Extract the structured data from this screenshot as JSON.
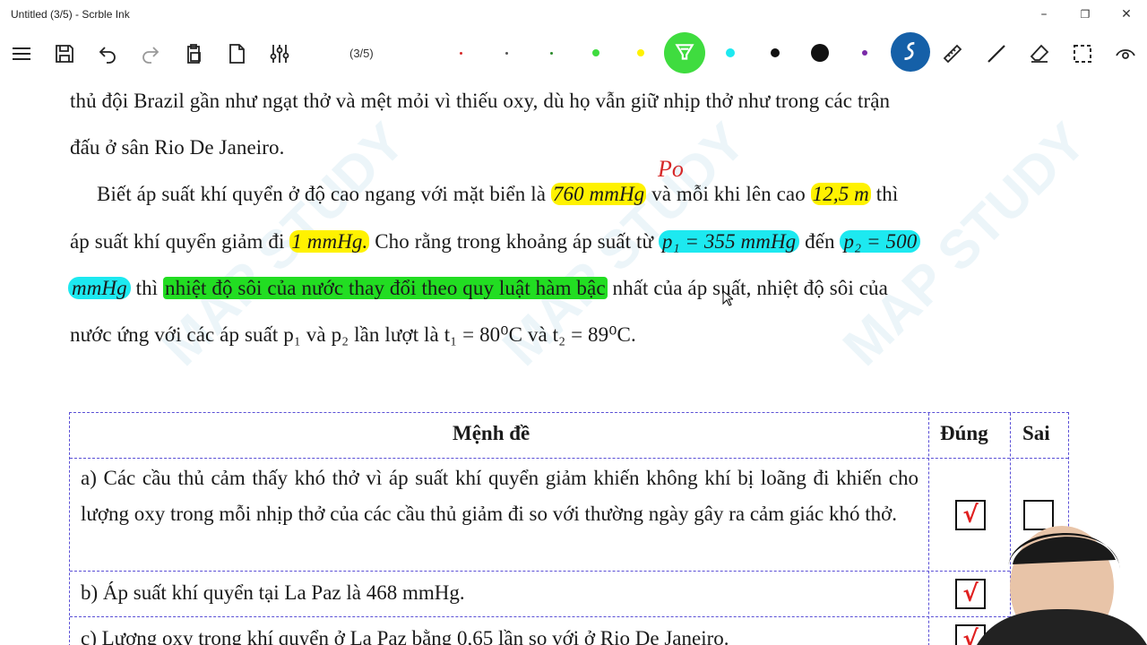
{
  "window": {
    "title": "Untitled (3/5) - Scrble Ink",
    "min": "–",
    "max": "❐",
    "close": "✕"
  },
  "toolbar": {
    "page_indicator": "(3/5)",
    "icons": [
      "menu-icon",
      "save-icon",
      "undo-icon",
      "redo-icon",
      "clipboard-icon",
      "page-icon",
      "sliders-icon",
      "highlighter-icon",
      "pen-icon",
      "ruler-icon",
      "line-icon",
      "eraser-icon",
      "selection-icon",
      "view-icon"
    ],
    "colors": {
      "highlight_green": "#3fdc3f",
      "pen_blue": "#1560a8",
      "yellow": "#fff200",
      "cyan": "#1de9f0",
      "green": "#22dd22",
      "black": "#111111",
      "purple": "#7a2aa8",
      "red": "#d62828"
    }
  },
  "doc": {
    "line1": "thủ đội Brazil gần như ngạt thở và mệt mỏi vì thiếu oxy, dù họ vẫn giữ nhịp thở như trong các trận",
    "line2": "đấu ở sân Rio De Janeiro.",
    "line3_a": "Biết áp suất khí quyển ở độ cao ngang với mặt  biển là ",
    "line3_hl1": "760 mmHg",
    "line3_b": " và mỗi khi lên cao ",
    "line3_hl2": "12,5 m",
    "line3_c": " thì",
    "line4_a": "áp suất khí quyển giảm đi ",
    "line4_hl1": "1 mmHg.",
    "line4_b": " Cho rằng trong khoảng áp suất từ ",
    "line4_hl2": "p₁ = 355 mmHg",
    "line4_c": " đến ",
    "line4_hl3": "p₂ = 500",
    "line5_hl1": "mmHg",
    "line5_a": " thì ",
    "line5_hl2": "nhiệt độ sôi của nước thay đổi theo quy luật hàm bậc",
    "line5_b": " nhất của áp suất, nhiệt độ sôi của",
    "line6": "nước ứng với các áp suất p₁ và p₂ lần lượt là t₁ = 80⁰C và t₂ = 89⁰C.",
    "annotation": "Po",
    "watermark": "MAP STUDY"
  },
  "table": {
    "headers": {
      "statement": "Mệnh đề",
      "true": "Đúng",
      "false": "Sai"
    },
    "rows": [
      {
        "text": "a) Các cầu thủ cảm thấy khó thở vì áp suất khí quyển giảm khiến không khí bị loãng đi khiến cho lượng oxy trong mỗi nhịp thở của các cầu thủ giảm đi so với thường ngày gây ra cảm giác khó thở.",
        "mark_true": "√",
        "mark_false": ""
      },
      {
        "text": "b) Áp suất khí quyển tại La Paz là 468 mmHg.",
        "mark_true": "√",
        "mark_false": ""
      },
      {
        "text": "c) Lượng oxy trong khí quyển ở La Paz bằng 0,65 lần so với ở Rio De Janeiro.",
        "mark_true": "√",
        "mark_false": ""
      }
    ]
  }
}
